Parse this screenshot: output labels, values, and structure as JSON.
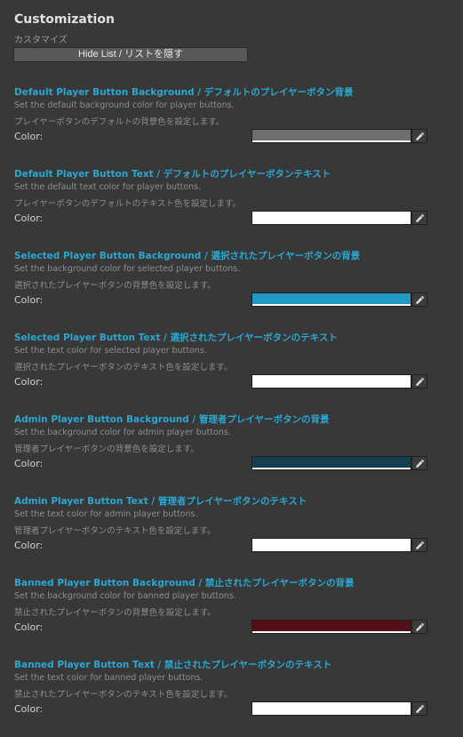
{
  "header": {
    "title": "Customization",
    "subtitle": "カスタマイズ",
    "hide_button_label": "Hide List / リストを隠す"
  },
  "sections": [
    {
      "title": "Default Player Button Background / デフォルトのプレイヤーボタン背景",
      "desc_en": "Set the default background color for player buttons.",
      "desc_jp": "プレイヤーボタンのデフォルトの背景色を設定します。",
      "label": "Color:",
      "color": "#6e6e6e"
    },
    {
      "title": "Default Player Button Text / デフォルトのプレイヤーボタンテキスト",
      "desc_en": "Set the default text color for player buttons.",
      "desc_jp": "プレイヤーボタンのデフォルトのテキスト色を設定します。",
      "label": "Color:",
      "color": "#ffffff"
    },
    {
      "title": "Selected Player Button Background / 選択されたプレイヤーボタンの背景",
      "desc_en": "Set the background color for selected player buttons.",
      "desc_jp": "選択されたプレイヤーボタンの背景色を設定します。",
      "label": "Color:",
      "color": "#1e9ac6"
    },
    {
      "title": "Selected Player Button Text / 選択されたプレイヤーボタンのテキスト",
      "desc_en": "Set the text color for selected player buttons.",
      "desc_jp": "選択されたプレイヤーボタンのテキスト色を設定します。",
      "label": "Color:",
      "color": "#ffffff"
    },
    {
      "title": "Admin Player Button Background / 管理者プレイヤーボタンの背景",
      "desc_en": "Set the background color for admin player buttons.",
      "desc_jp": "管理者プレイヤーボタンの背景色を設定します。",
      "label": "Color:",
      "color": "#133f50"
    },
    {
      "title": "Admin Player Button Text / 管理者プレイヤーボタンのテキスト",
      "desc_en": "Set the text color for admin player buttons.",
      "desc_jp": "管理者プレイヤーボタンのテキスト色を設定します。",
      "label": "Color:",
      "color": "#ffffff"
    },
    {
      "title": "Banned Player Button Background / 禁止されたプレイヤーボタンの背景",
      "desc_en": "Set the background color for banned player buttons.",
      "desc_jp": "禁止されたプレイヤーボタンの背景色を設定します。",
      "label": "Color:",
      "color": "#541017"
    },
    {
      "title": "Banned Player Button Text / 禁止されたプレイヤーボタンのテキスト",
      "desc_en": "Set the text color for banned player buttons.",
      "desc_jp": "禁止されたプレイヤーボタンのテキスト色を設定します。",
      "label": "Color:",
      "color": "#ffffff"
    }
  ],
  "icons": {
    "picker": "eyedropper-icon"
  }
}
